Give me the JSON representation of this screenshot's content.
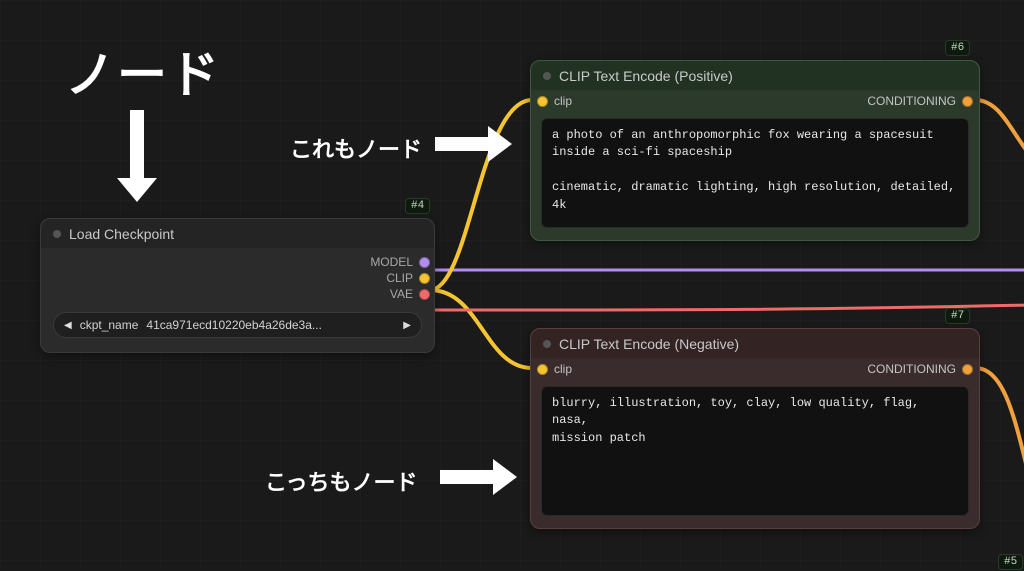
{
  "annotations": {
    "main": "ノード",
    "also1": "これもノード",
    "also2": "こっちもノード"
  },
  "tags": {
    "loadCheckpoint": "#4",
    "clipPos": "#6",
    "clipNeg": "#7",
    "offscreen": "#5"
  },
  "loadCheckpoint": {
    "title": "Load Checkpoint",
    "outputs": {
      "model": "MODEL",
      "clip": "CLIP",
      "vae": "VAE"
    },
    "paramLabel": "ckpt_name",
    "paramValue": "41ca971ecd10220eb4a26de3a..."
  },
  "clipPos": {
    "title": "CLIP Text Encode (Positive)",
    "inputLabel": "clip",
    "outputLabel": "CONDITIONING",
    "prompt": "a photo of an anthropomorphic fox wearing a spacesuit\ninside a sci-fi spaceship\n\ncinematic, dramatic lighting, high resolution, detailed,\n4k"
  },
  "clipNeg": {
    "title": "CLIP Text Encode (Negative)",
    "inputLabel": "clip",
    "outputLabel": "CONDITIONING",
    "prompt": "blurry, illustration, toy, clay, low quality, flag, nasa,\nmission patch"
  },
  "colors": {
    "modelPort": "#b28cf0",
    "clipPort": "#f5c431",
    "vaePort": "#f06a6a",
    "condPort": "#f0a03c"
  }
}
